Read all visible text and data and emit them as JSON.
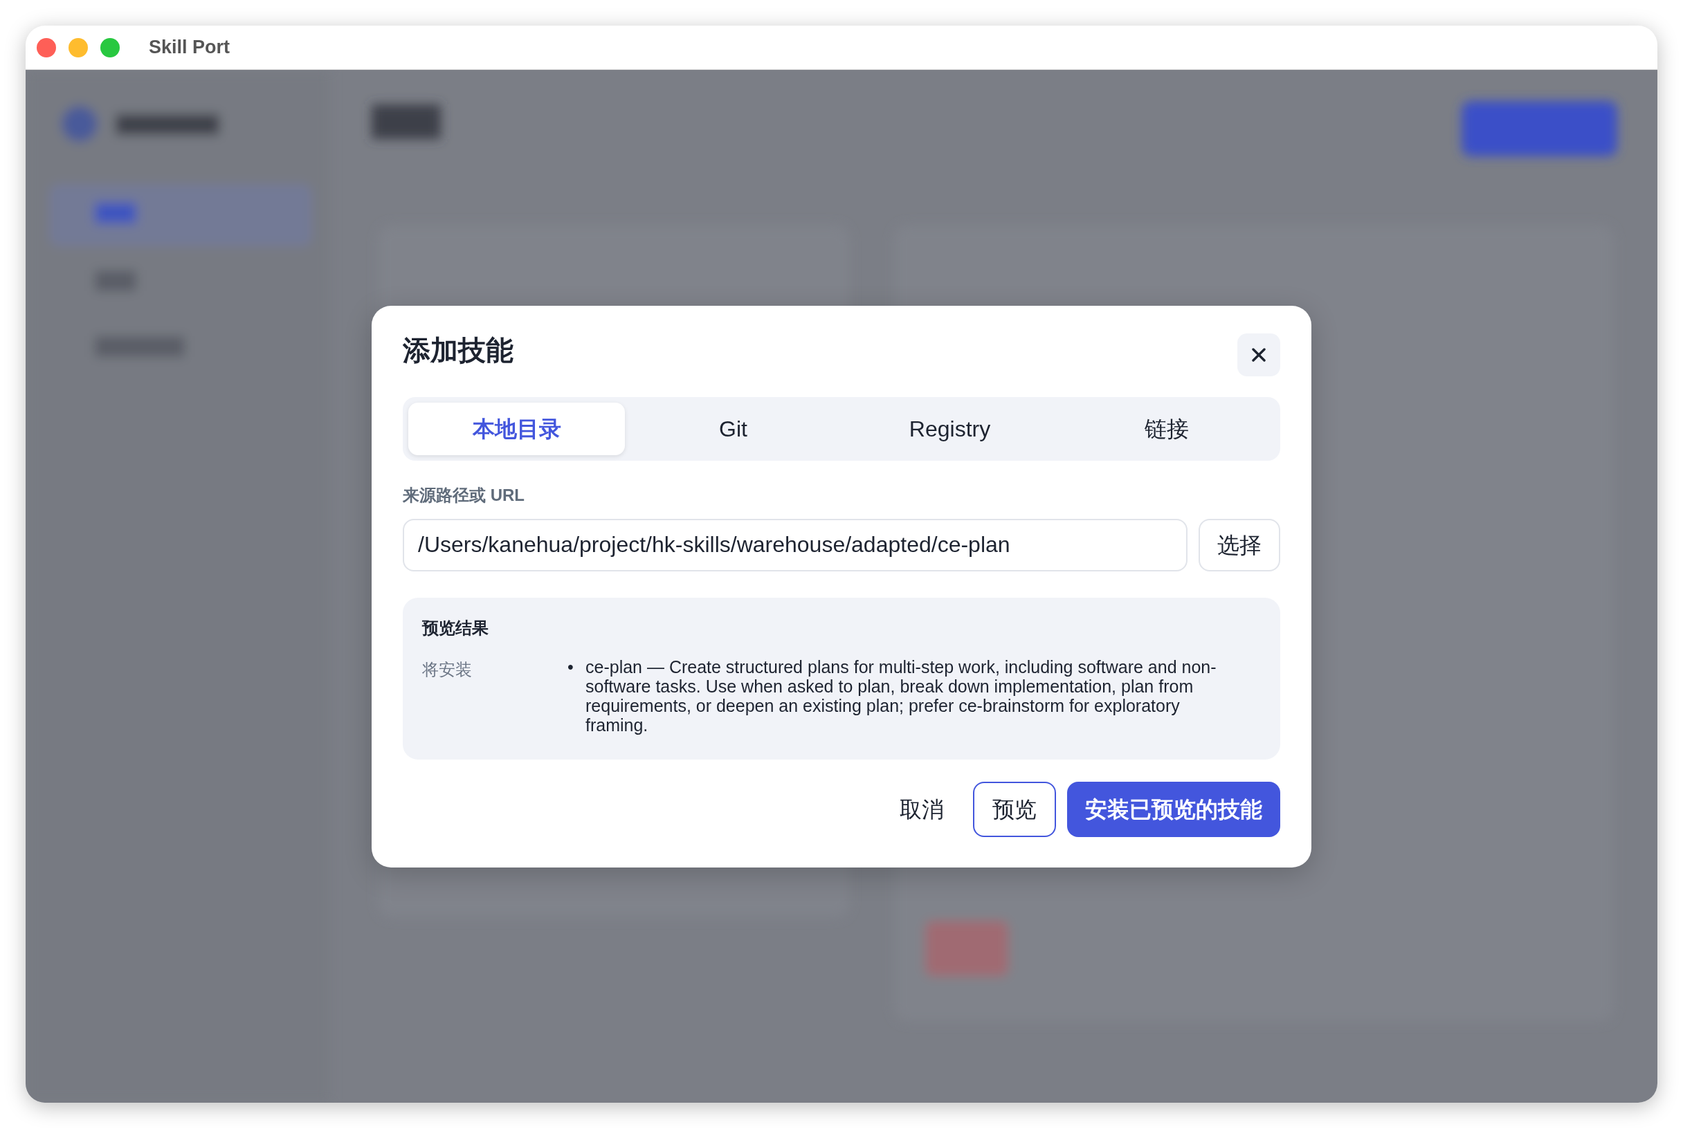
{
  "window": {
    "title": "Skill Port"
  },
  "dialog": {
    "title": "添加技能",
    "tabs": [
      {
        "label": "本地目录",
        "selected": true
      },
      {
        "label": "Git",
        "selected": false
      },
      {
        "label": "Registry",
        "selected": false
      },
      {
        "label": "链接",
        "selected": false
      }
    ],
    "source": {
      "label": "来源路径或 URL",
      "value": "/Users/kanehua/project/hk-skills/warehouse/adapted/ce-plan",
      "button": "选择"
    },
    "preview": {
      "title": "预览结果",
      "rows": [
        {
          "label": "将安装",
          "items": [
            {
              "bullet": "•",
              "text": "ce-plan — Create structured plans for multi-step work, including software and non-software tasks. Use when asked to plan, break down implementation, plan from requirements, or deepen an existing plan; prefer ce-brainstorm for exploratory framing."
            }
          ]
        }
      ]
    },
    "buttons": [
      {
        "label": "取消",
        "kind": "text"
      },
      {
        "label": "预览",
        "kind": "outline"
      },
      {
        "label": "安装已预览的技能",
        "kind": "primary"
      }
    ]
  }
}
